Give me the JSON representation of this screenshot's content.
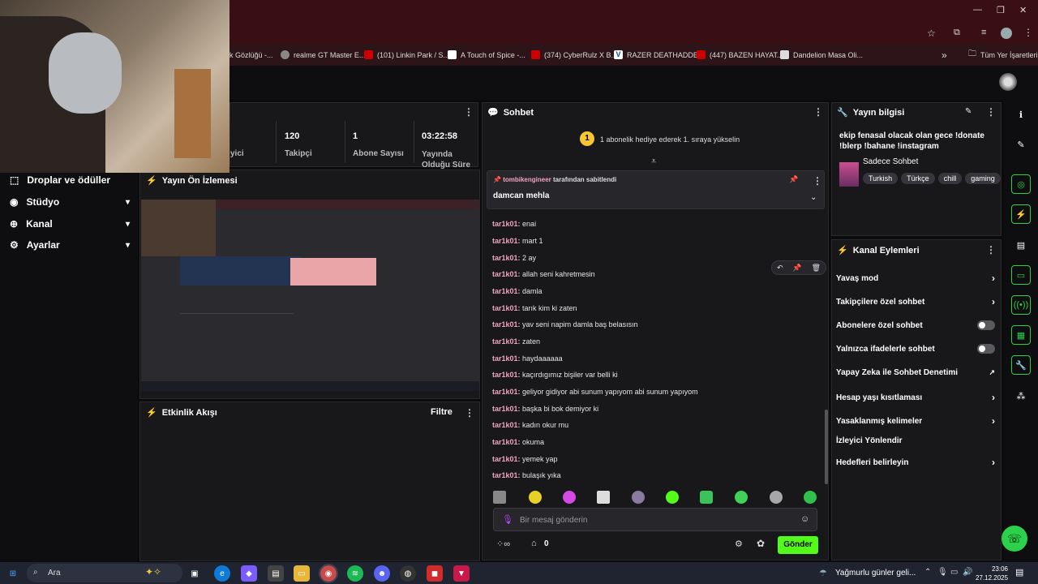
{
  "browser": {
    "bookmarks": [
      {
        "label": "k Gözlüğü -..."
      },
      {
        "label": "realme GT Master E..."
      },
      {
        "label": "(101) Linkin Park / S..."
      },
      {
        "label": "A Touch of Spice -..."
      },
      {
        "label": "(374) CyberRulz X B..."
      },
      {
        "label": "RAZER DEATHADDE..."
      },
      {
        "label": "(447) BAZEN HAYAT..."
      },
      {
        "label": "Dandelion Masa Oli..."
      }
    ],
    "more_bookmarks": "»",
    "all_bookmarks": "Tüm Yer İşaretleri"
  },
  "stats": {
    "viewers_label": "yici",
    "followers_value": "120",
    "followers_label": "Takipçi",
    "subs_value": "1",
    "subs_label": "Abone Sayısı",
    "uptime_value": "03:22:58",
    "uptime_label": "Yayında Olduğu Süre"
  },
  "sidebar": {
    "items": [
      {
        "label": "Droplar ve ödüller"
      },
      {
        "label": "Stüdyo"
      },
      {
        "label": "Kanal"
      },
      {
        "label": "Ayarlar"
      }
    ]
  },
  "preview": {
    "title": "Yayın Ön İzlemesi"
  },
  "activity": {
    "title": "Etkinlik Akışı",
    "filter": "Filtre"
  },
  "chat": {
    "title": "Sohbet",
    "hype_badge": "1",
    "hype_text": "1 abonelik hediye ederek 1. sıraya yükselin",
    "pinned_by_user": "tombikengineer",
    "pinned_by_suffix": "tarafından sabitlendi",
    "pinned_message": "damcan mehla",
    "messages": [
      {
        "user": "tar1k01:",
        "text": "enai"
      },
      {
        "user": "tar1k01:",
        "text": "mart 1"
      },
      {
        "user": "tar1k01:",
        "text": "2 ay"
      },
      {
        "user": "tar1k01:",
        "text": "allah seni kahretmesin"
      },
      {
        "user": "tar1k01:",
        "text": "damla"
      },
      {
        "user": "tar1k01:",
        "text": "tarık kim ki zaten"
      },
      {
        "user": "tar1k01:",
        "text": "yav seni napim damla baş belasısın"
      },
      {
        "user": "tar1k01:",
        "text": "zaten"
      },
      {
        "user": "tar1k01:",
        "text": "haydaaaaaa"
      },
      {
        "user": "tar1k01:",
        "text": "kaçırdıgımız bişiler var belli ki"
      },
      {
        "user": "tar1k01:",
        "text": "geliyor gidiyor abi sunum yapıyom abi sunum yapıyom"
      },
      {
        "user": "tar1k01:",
        "text": "başka bi bok demiyor ki"
      },
      {
        "user": "tar1k01:",
        "text": "kadın okur mu"
      },
      {
        "user": "tar1k01:",
        "text": "okuma"
      },
      {
        "user": "tar1k01:",
        "text": "yemek yap"
      },
      {
        "user": "tar1k01:",
        "text": "bulaşık yıka"
      }
    ],
    "input_placeholder": "Bir mesaj gönderin",
    "points_count": "0",
    "send_label": "Gönder"
  },
  "stream_info": {
    "title": "Yayın bilgisi",
    "stream_title": "ekip fenasal olacak olan gece !donate !blerp !bahane !instagram",
    "category": "Sadece Sohbet",
    "tags": [
      "Turkish",
      "Türkçe",
      "chill",
      "gaming"
    ]
  },
  "channel_actions": {
    "title": "Kanal Eylemleri",
    "items": [
      {
        "label": "Yavaş mod",
        "control": "chevron"
      },
      {
        "label": "Takipçilere özel sohbet",
        "control": "chevron"
      },
      {
        "label": "Abonelere özel sohbet",
        "control": "toggle"
      },
      {
        "label": "Yalnızca ifadelerle sohbet",
        "control": "toggle"
      },
      {
        "label": "Yapay Zeka ile Sohbet Denetimi",
        "control": "external"
      },
      {
        "label": "Hesap yaşı kısıtlaması",
        "control": "chevron"
      },
      {
        "label": "Yasaklanmış kelimeler",
        "control": "chevron"
      },
      {
        "label": "İzleyici Yönlendir",
        "control": "none"
      },
      {
        "label": "Hedefleri belirleyin",
        "control": "chevron"
      }
    ]
  },
  "taskbar": {
    "search": "Ara",
    "weather": "Yağmurlu günler geli...",
    "time": "23:06",
    "date": "27.12.2025"
  },
  "colors": {
    "accent": "#53fc18",
    "username": "#f2a3c0",
    "browser_frame": "#3a0f14"
  }
}
